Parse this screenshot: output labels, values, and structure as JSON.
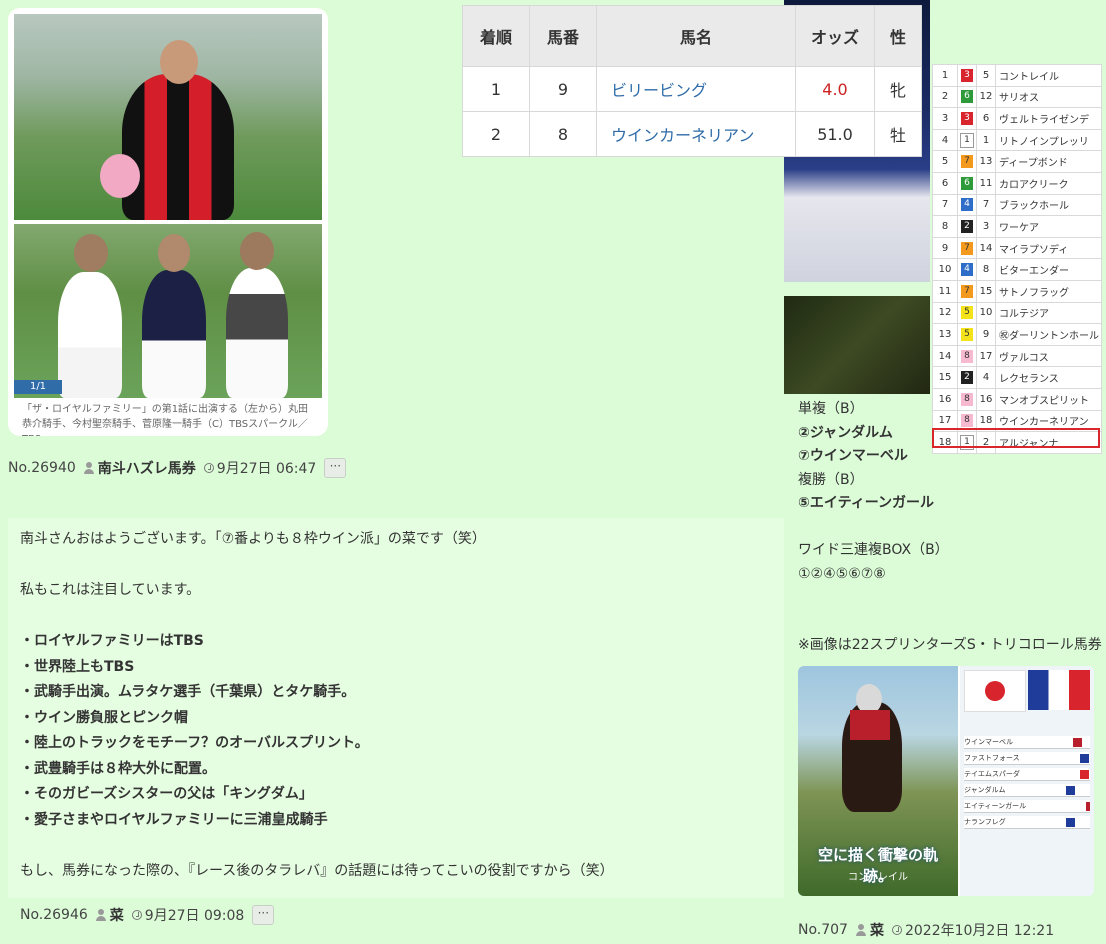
{
  "left_post": {
    "photo_counter": "1/1",
    "caption": "「ザ・ロイヤルファミリー」の第1話に出演する（左から）丸田恭介騎手、今村聖奈騎手、菅原隆一騎手（C）TBSスパークル／TBS",
    "meta": {
      "no": "No.26940",
      "user": "南斗ハズレ馬券",
      "time": "9月27日 06:47",
      "more": "···"
    }
  },
  "reply_post": {
    "lines": [
      "南斗さんおはようございます。「⑦番よりも８枠ウイン派」の菜です（笑）",
      "",
      "私もこれは注目しています。",
      "",
      "・ロイヤルファミリーはTBS",
      "・世界陸上もTBS",
      "・武騎手出演。ムラタケ選手（千葉県）とタケ騎手。",
      "・ウイン勝負服とピンク帽",
      "・陸上のトラックをモチーフ？のオーバルスプリント。",
      "・武豊騎手は８枠大外に配置。",
      "・そのガビーズシスターの父は「キングダム」",
      "・愛子さまやロイヤルファミリーに三浦皇成騎手",
      "",
      "もし、馬券になった際の、『レース後のタラレバ』の話題には待ってこいの役割ですから（笑）"
    ],
    "meta": {
      "no": "No.26946",
      "user": "菜",
      "time": "9月27日 09:08",
      "more": "···"
    }
  },
  "results_table": {
    "headers": [
      "着順",
      "馬番",
      "馬名",
      "オッズ",
      "性"
    ],
    "rows": [
      {
        "rank": "1",
        "num": "9",
        "name": "ビリービング",
        "odds": "4.0",
        "sex": "牝",
        "odds_highlight": true
      },
      {
        "rank": "2",
        "num": "8",
        "name": "ウインカーネリアン",
        "odds": "51.0",
        "sex": "牡",
        "odds_highlight": false
      }
    ]
  },
  "entries": [
    {
      "n": "1",
      "w": "3",
      "u": "5",
      "horse": "コントレイル",
      "wc": "#d8242d",
      "wt": "#fff"
    },
    {
      "n": "2",
      "w": "6",
      "u": "12",
      "horse": "サリオス",
      "wc": "#2e9a3a",
      "wt": "#fff"
    },
    {
      "n": "3",
      "w": "3",
      "u": "6",
      "horse": "ヴェルトライゼンデ",
      "wc": "#d8242d",
      "wt": "#fff"
    },
    {
      "n": "4",
      "w": "1",
      "u": "1",
      "horse": "リトノインプレッリ",
      "wc": "#ffffff",
      "wt": "#333"
    },
    {
      "n": "5",
      "w": "7",
      "u": "13",
      "horse": "ディープボンド",
      "wc": "#f39a1e",
      "wt": "#333"
    },
    {
      "n": "6",
      "w": "6",
      "u": "11",
      "horse": "カロアクリーク",
      "wc": "#2e9a3a",
      "wt": "#fff"
    },
    {
      "n": "7",
      "w": "4",
      "u": "7",
      "horse": "ブラックホール",
      "wc": "#2f6ec8",
      "wt": "#fff"
    },
    {
      "n": "8",
      "w": "2",
      "u": "3",
      "horse": "ワーケア",
      "wc": "#222222",
      "wt": "#fff"
    },
    {
      "n": "9",
      "w": "7",
      "u": "14",
      "horse": "マイラプソディ",
      "wc": "#f39a1e",
      "wt": "#333"
    },
    {
      "n": "10",
      "w": "4",
      "u": "8",
      "horse": "ビターエンダー",
      "wc": "#2f6ec8",
      "wt": "#fff"
    },
    {
      "n": "11",
      "w": "7",
      "u": "15",
      "horse": "サトノフラッグ",
      "wc": "#f39a1e",
      "wt": "#333"
    },
    {
      "n": "12",
      "w": "5",
      "u": "10",
      "horse": "コルテジア",
      "wc": "#f4e21a",
      "wt": "#333"
    },
    {
      "n": "13",
      "w": "5",
      "u": "9",
      "horse": "㊗ダーリントンホール",
      "wc": "#f4e21a",
      "wt": "#333"
    },
    {
      "n": "14",
      "w": "8",
      "u": "17",
      "horse": "ヴァルコス",
      "wc": "#f6b9cf",
      "wt": "#333"
    },
    {
      "n": "15",
      "w": "2",
      "u": "4",
      "horse": "レクセランス",
      "wc": "#222222",
      "wt": "#fff"
    },
    {
      "n": "16",
      "w": "8",
      "u": "16",
      "horse": "マンオブスピリット",
      "wc": "#f6b9cf",
      "wt": "#333"
    },
    {
      "n": "17",
      "w": "8",
      "u": "18",
      "horse": "ウインカーネリアン",
      "wc": "#f6b9cf",
      "wt": "#333"
    },
    {
      "n": "18",
      "w": "1",
      "u": "2",
      "horse": "アルジャンナ",
      "wc": "#ffffff",
      "wt": "#333"
    }
  ],
  "picks": {
    "lines": [
      {
        "text": "単複（B）",
        "bold": false
      },
      {
        "text": "②ジャンダルム",
        "bold": true
      },
      {
        "text": "⑦ウインマーベル",
        "bold": true
      },
      {
        "text": "複勝（B）",
        "bold": false
      },
      {
        "text": "⑤エイティーンガール",
        "bold": true
      },
      {
        "text": "",
        "bold": false
      },
      {
        "text": "ワイド三連複BOX（B）",
        "bold": false
      },
      {
        "text": "①②④⑤⑥⑦⑧",
        "bold": false
      }
    ],
    "note": "※画像は22スプリンターズS・トリコロール馬券"
  },
  "poster": {
    "title": "空に描く衝撃の軌跡。",
    "subtitle": "コントレイル",
    "mini_rows": [
      "ウインマーベル",
      "ファストフォース",
      "テイエムスパーダ",
      "ジャンダルム",
      "エイティーンガール",
      "ナランフレグ"
    ]
  },
  "right_meta": {
    "no": "No.707",
    "user": "菜",
    "time": "2022年10月2日 12:21"
  }
}
